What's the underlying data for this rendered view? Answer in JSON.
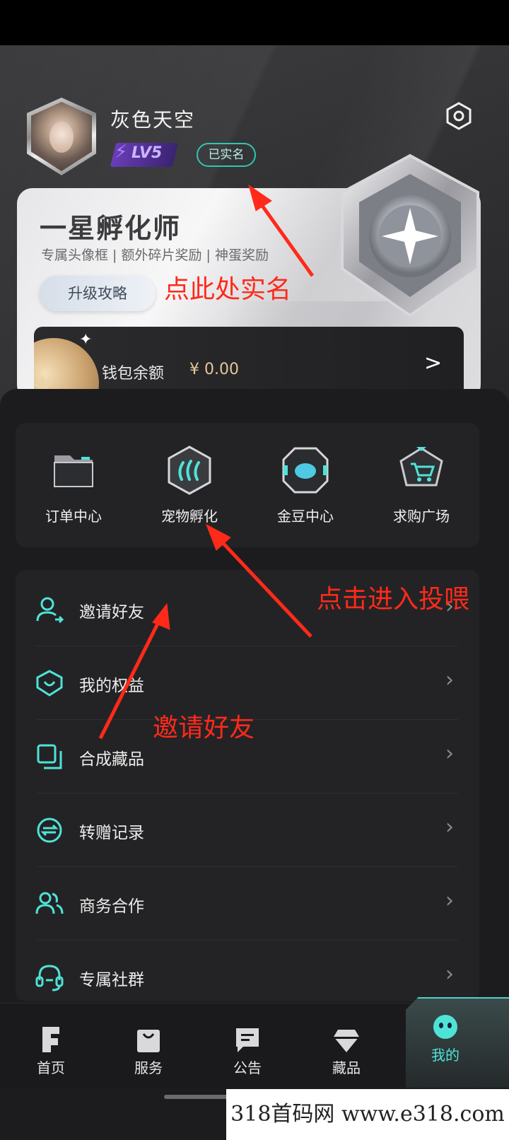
{
  "profile": {
    "username": "灰色天空",
    "level": "LV5",
    "verified_label": "已实名"
  },
  "level_card": {
    "title": "一星孵化师",
    "perks": "专属头像框 |  额外碎片奖励 |  神蛋奖励",
    "upgrade_button": "升级攻略"
  },
  "wallet": {
    "label": "钱包余额",
    "amount": "¥ 0.00",
    "arrow": ">"
  },
  "quick_actions": [
    {
      "label": "订单中心",
      "icon": "folder-icon"
    },
    {
      "label": "宠物孵化",
      "icon": "hatch-icon"
    },
    {
      "label": "金豆中心",
      "icon": "bean-icon"
    },
    {
      "label": "求购广场",
      "icon": "cart-icon"
    }
  ],
  "menu": [
    {
      "label": "邀请好友",
      "icon": "invite-user-icon"
    },
    {
      "label": "我的权益",
      "icon": "rights-shield-icon"
    },
    {
      "label": "合成藏品",
      "icon": "compose-icon"
    },
    {
      "label": "转赠记录",
      "icon": "transfer-icon"
    },
    {
      "label": "商务合作",
      "icon": "users-icon"
    },
    {
      "label": "专属社群",
      "icon": "headset-icon"
    }
  ],
  "annotations": {
    "verify": "点此处实名",
    "feed": "点击进入投喂",
    "invite": "邀请好友"
  },
  "tabbar": [
    {
      "label": "首页",
      "icon": "home-f-icon"
    },
    {
      "label": "服务",
      "icon": "bag-icon"
    },
    {
      "label": "公告",
      "icon": "message-icon"
    },
    {
      "label": "藏品",
      "icon": "diamond-icon"
    },
    {
      "label": "我的",
      "icon": "mascot-icon",
      "active": true
    }
  ],
  "watermark": "318首码网  www.e318.com",
  "colors": {
    "accent": "#4fe3d8",
    "annotation": "#ff2a1a",
    "wallet_amount": "#e3c79a",
    "level_badge": "#6a3db8"
  }
}
